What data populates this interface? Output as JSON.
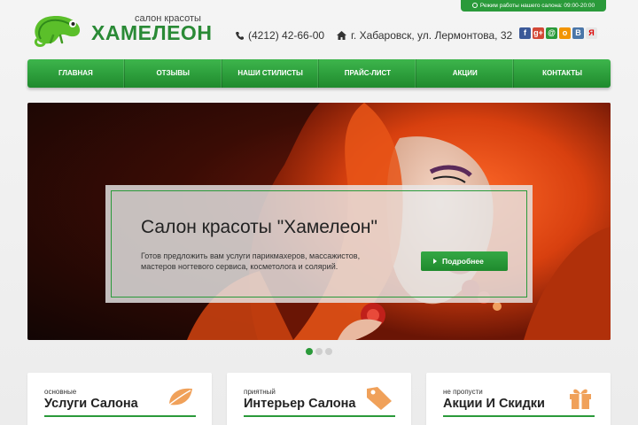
{
  "hours": {
    "text": "Режим работы нашего салона: 09:00-20:00"
  },
  "header": {
    "logo_sub": "салон красоты",
    "logo_main": "ХАМЕЛЕОН",
    "phone": "(4212) 42-66-00",
    "address": "г. Хабаровск, ул. Лермонтова, 32",
    "social": [
      {
        "icon": "facebook-icon",
        "glyph": "f",
        "color": "#3b5998"
      },
      {
        "icon": "google-plus-icon",
        "glyph": "g+",
        "color": "#d34836"
      },
      {
        "icon": "mailru-icon",
        "glyph": "@",
        "color": "#2a9a3a"
      },
      {
        "icon": "odnoklassniki-icon",
        "glyph": "o",
        "color": "#f29400"
      },
      {
        "icon": "vkontakte-icon",
        "glyph": "B",
        "color": "#4a76a8"
      },
      {
        "icon": "yandex-icon",
        "glyph": "Я",
        "color": "#e6e6e6"
      }
    ]
  },
  "nav": {
    "items": [
      "ГЛАВНАЯ",
      "ОТЗЫВЫ",
      "НАШИ СТИЛИСТЫ",
      "ПРАЙС-ЛИСТ",
      "АКЦИИ",
      "КОНТАКТЫ"
    ]
  },
  "hero": {
    "title": "Салон красоты \"Хамелеон\"",
    "desc": "Готов предложить вам услуги парикмахеров, массажистов, мастеров ногтевого сервиса, косметолога и солярий.",
    "button": "Подробнее"
  },
  "cards": [
    {
      "kicker": "основные",
      "title": "Услуги Салона",
      "icon": "leaf-icon"
    },
    {
      "kicker": "приятный",
      "title": "Интерьер Салона",
      "icon": "tag-icon"
    },
    {
      "kicker": "не пропусти",
      "title": "Акции И Скидки",
      "icon": "gift-icon"
    }
  ],
  "colors": {
    "accent": "#2a9a3a",
    "icon_orange": "#f0a15a"
  }
}
